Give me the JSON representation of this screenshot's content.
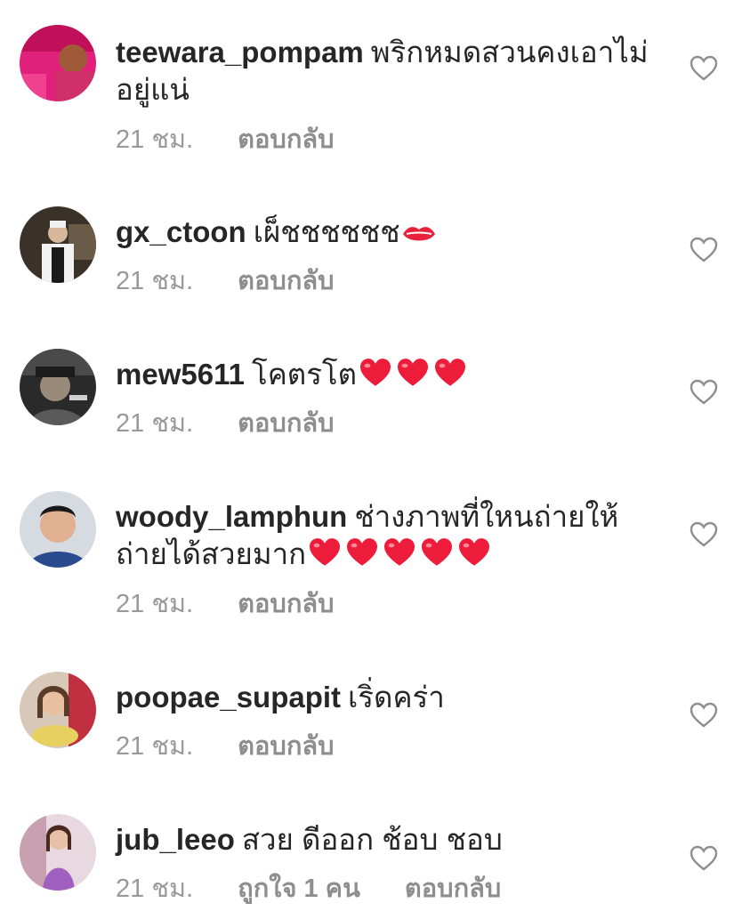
{
  "comments": [
    {
      "username": "teewara_pompam",
      "text": "พริกหมดสวนคงเอาไม่อยู่แน่",
      "time": "21 ชม.",
      "likes": "",
      "reply": "ตอบกลับ",
      "avatar_icon": "profile-photo",
      "emojis": []
    },
    {
      "username": "gx_ctoon",
      "text": "เผ็ชชชชชช",
      "time": "21 ชม.",
      "likes": "",
      "reply": "ตอบกลับ",
      "avatar_icon": "profile-photo",
      "emojis": [
        "lips"
      ]
    },
    {
      "username": "mew5611",
      "text": "โคตรโต",
      "time": "21 ชม.",
      "likes": "",
      "reply": "ตอบกลับ",
      "avatar_icon": "profile-photo",
      "emojis": [
        "heart",
        "heart",
        "heart"
      ]
    },
    {
      "username": "woody_lamphun",
      "text": "ช่างภาพที่ใหนถ่ายให้ถ่ายได้สวยมาก",
      "time": "21 ชม.",
      "likes": "",
      "reply": "ตอบกลับ",
      "avatar_icon": "profile-photo",
      "emojis": [
        "heart",
        "heart",
        "heart",
        "heart",
        "heart"
      ]
    },
    {
      "username": "poopae_supapit",
      "text": "เริ่ดคร่า",
      "time": "21 ชม.",
      "likes": "",
      "reply": "ตอบกลับ",
      "avatar_icon": "profile-photo",
      "emojis": []
    },
    {
      "username": "jub_leeo",
      "text": "สวย ดีออก ช้อบ ชอบ",
      "time": "21 ชม.",
      "likes": "ถูกใจ 1 คน",
      "reply": "ตอบกลับ",
      "avatar_icon": "profile-photo",
      "emojis": []
    }
  ],
  "colors": {
    "text": "#262626",
    "meta": "#8e8e8e",
    "heart_outline": "#8e8e8e",
    "emoji_heart": "#ed1c3a"
  },
  "icons": {
    "like": "heart-outline-icon",
    "emoji_heart": "red-heart-emoji",
    "emoji_lips": "lips-emoji"
  }
}
